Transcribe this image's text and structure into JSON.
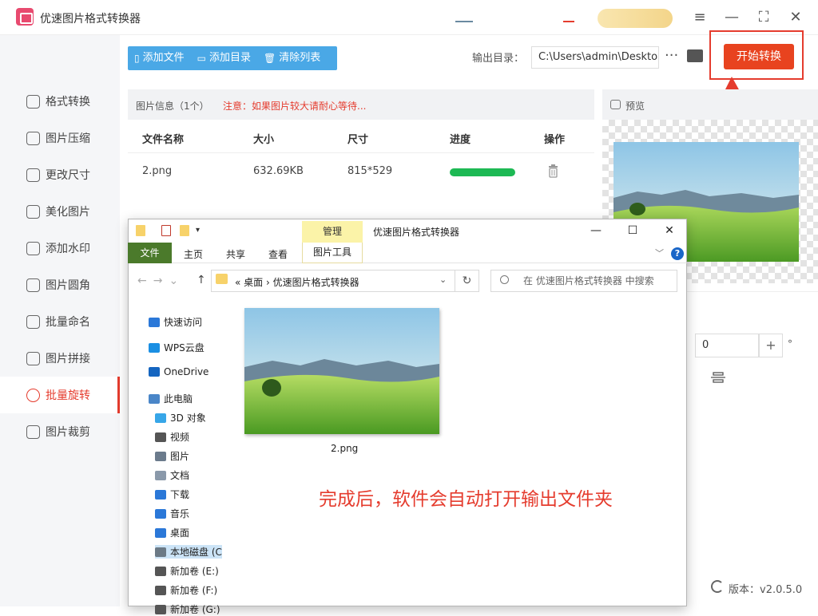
{
  "app": {
    "title": "优速图片格式转换器"
  },
  "window_controls": {
    "menu": "≡",
    "minimize": "—",
    "maximize": "⛶",
    "close": "✕"
  },
  "sidebar": {
    "items": [
      {
        "label": "格式转换",
        "icon": "format-convert-icon",
        "active": false
      },
      {
        "label": "图片压缩",
        "icon": "compress-icon",
        "active": false
      },
      {
        "label": "更改尺寸",
        "icon": "resize-icon",
        "active": false
      },
      {
        "label": "美化图片",
        "icon": "beautify-icon",
        "active": false
      },
      {
        "label": "添加水印",
        "icon": "watermark-icon",
        "active": false
      },
      {
        "label": "图片圆角",
        "icon": "round-corner-icon",
        "active": false
      },
      {
        "label": "批量命名",
        "icon": "rename-icon",
        "active": false
      },
      {
        "label": "图片拼接",
        "icon": "stitch-icon",
        "active": false
      },
      {
        "label": "批量旋转",
        "icon": "rotate-icon",
        "active": true
      },
      {
        "label": "图片裁剪",
        "icon": "crop-icon",
        "active": false
      }
    ]
  },
  "toolbar": {
    "add_file": "添加文件",
    "add_folder": "添加目录",
    "clear_list": "清除列表"
  },
  "output": {
    "label": "输出目录：",
    "path": "C:\\Users\\admin\\Deskto",
    "more": "···"
  },
  "start_button": "开始转换",
  "file_list": {
    "title": "图片信息（1个）",
    "warning": "注意：如果图片较大请耐心等待...",
    "columns": [
      "文件名称",
      "大小",
      "尺寸",
      "进度",
      "操作"
    ],
    "rows": [
      {
        "name": "2.png",
        "size": "632.69KB",
        "dimensions": "815*529",
        "progress": 1.0
      }
    ]
  },
  "preview": {
    "label": "预览"
  },
  "rotate": {
    "angle": "0",
    "plus": "+",
    "unit": "°"
  },
  "version": "版本：v2.0.5.0",
  "explorer": {
    "title": "优速图片格式转换器",
    "manage_tab": "管理",
    "picture_tools_tab": "图片工具",
    "tabs": [
      "文件",
      "主页",
      "共享",
      "查看"
    ],
    "breadcrumb": "«  桌面  ›  优速图片格式转换器",
    "search_placeholder": "在 优速图片格式转换器 中搜索",
    "tree": [
      {
        "label": "快速访问",
        "icon": "star-icon",
        "color": "#2b78d8"
      },
      {
        "label": "WPS云盘",
        "icon": "cloud-icon",
        "color": "#1a8fe3"
      },
      {
        "label": "OneDrive",
        "icon": "onedrive-icon",
        "color": "#1565c0"
      },
      {
        "label": "此电脑",
        "icon": "computer-icon",
        "color": "#4a86c8"
      },
      {
        "label": "3D 对象",
        "icon": "cube-icon",
        "color": "#37a6e8"
      },
      {
        "label": "视频",
        "icon": "video-icon",
        "color": "#555555"
      },
      {
        "label": "图片",
        "icon": "pictures-icon",
        "color": "#6b7b8c"
      },
      {
        "label": "文档",
        "icon": "documents-icon",
        "color": "#8a99aa"
      },
      {
        "label": "下载",
        "icon": "download-icon",
        "color": "#2b78d8"
      },
      {
        "label": "音乐",
        "icon": "music-icon",
        "color": "#2b78d8"
      },
      {
        "label": "桌面",
        "icon": "desktop-icon",
        "color": "#2b78d8"
      },
      {
        "label": "本地磁盘 (C",
        "icon": "disk-icon",
        "color": "#6c7a86"
      },
      {
        "label": "新加卷 (E:)",
        "icon": "disk-icon",
        "color": "#555555"
      },
      {
        "label": "新加卷 (F:)",
        "icon": "disk-icon",
        "color": "#555555"
      },
      {
        "label": "新加卷 (G:)",
        "icon": "disk-icon",
        "color": "#555555"
      }
    ],
    "file": {
      "name": "2.png"
    }
  },
  "annotation": "完成后，软件会自动打开输出文件夹",
  "colors": {
    "accent": "#e53c2e",
    "toolbar": "#4aa8e6",
    "start": "#e8431f",
    "progress": "#1db954"
  }
}
